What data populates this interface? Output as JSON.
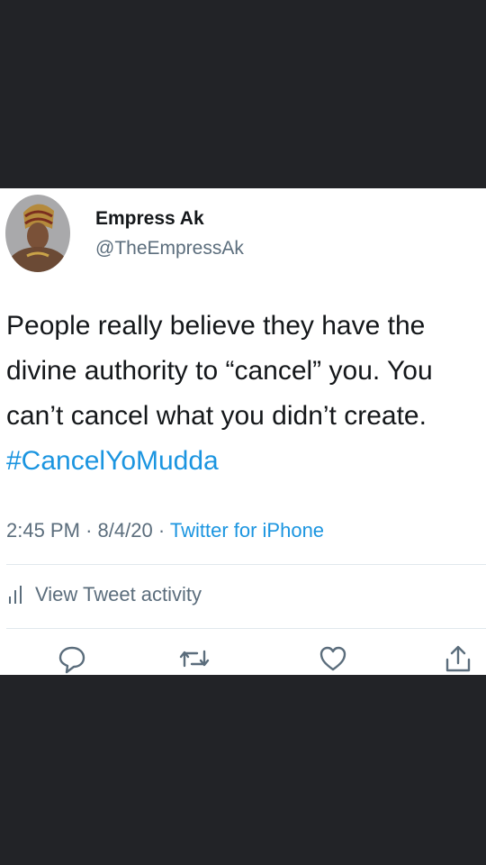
{
  "tweet": {
    "display_name": "Empress Ak",
    "handle": "@TheEmpressAk",
    "body_lines": [
      "People really believe they have the",
      "divine authority to “cancel” you. You",
      "can’t cancel what you didn’t create."
    ],
    "hashtag": "#CancelYoMudda",
    "time": "2:45 PM",
    "date": "8/4/20",
    "separator": "·",
    "source": "Twitter for iPhone",
    "activity_label": "View Tweet activity"
  },
  "actions": {
    "icons": [
      "reply-icon",
      "retweet-icon",
      "like-icon",
      "share-icon"
    ]
  },
  "colors": {
    "background": "#222327",
    "card": "#ffffff",
    "text": "#14171a",
    "secondary": "#5b6d7c",
    "link": "#1b95e0",
    "divider": "#e1e8ed"
  }
}
